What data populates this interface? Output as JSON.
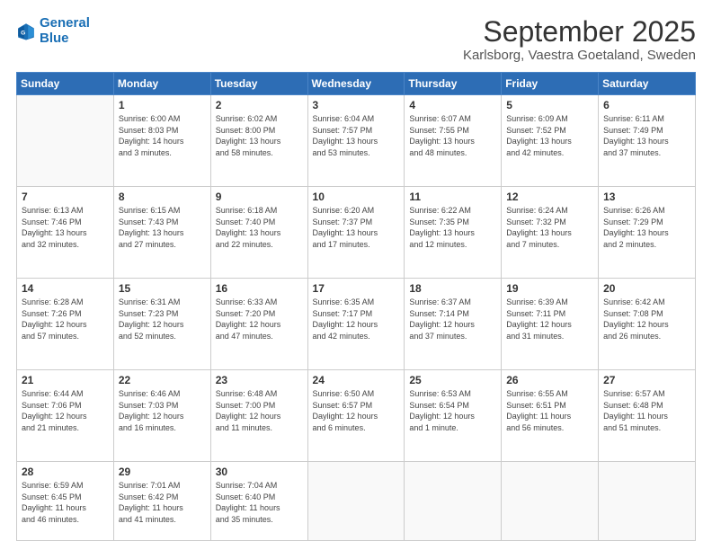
{
  "logo": {
    "line1": "General",
    "line2": "Blue"
  },
  "header": {
    "month": "September 2025",
    "location": "Karlsborg, Vaestra Goetaland, Sweden"
  },
  "weekdays": [
    "Sunday",
    "Monday",
    "Tuesday",
    "Wednesday",
    "Thursday",
    "Friday",
    "Saturday"
  ],
  "weeks": [
    [
      {
        "day": "",
        "info": ""
      },
      {
        "day": "1",
        "info": "Sunrise: 6:00 AM\nSunset: 8:03 PM\nDaylight: 14 hours\nand 3 minutes."
      },
      {
        "day": "2",
        "info": "Sunrise: 6:02 AM\nSunset: 8:00 PM\nDaylight: 13 hours\nand 58 minutes."
      },
      {
        "day": "3",
        "info": "Sunrise: 6:04 AM\nSunset: 7:57 PM\nDaylight: 13 hours\nand 53 minutes."
      },
      {
        "day": "4",
        "info": "Sunrise: 6:07 AM\nSunset: 7:55 PM\nDaylight: 13 hours\nand 48 minutes."
      },
      {
        "day": "5",
        "info": "Sunrise: 6:09 AM\nSunset: 7:52 PM\nDaylight: 13 hours\nand 42 minutes."
      },
      {
        "day": "6",
        "info": "Sunrise: 6:11 AM\nSunset: 7:49 PM\nDaylight: 13 hours\nand 37 minutes."
      }
    ],
    [
      {
        "day": "7",
        "info": "Sunrise: 6:13 AM\nSunset: 7:46 PM\nDaylight: 13 hours\nand 32 minutes."
      },
      {
        "day": "8",
        "info": "Sunrise: 6:15 AM\nSunset: 7:43 PM\nDaylight: 13 hours\nand 27 minutes."
      },
      {
        "day": "9",
        "info": "Sunrise: 6:18 AM\nSunset: 7:40 PM\nDaylight: 13 hours\nand 22 minutes."
      },
      {
        "day": "10",
        "info": "Sunrise: 6:20 AM\nSunset: 7:37 PM\nDaylight: 13 hours\nand 17 minutes."
      },
      {
        "day": "11",
        "info": "Sunrise: 6:22 AM\nSunset: 7:35 PM\nDaylight: 13 hours\nand 12 minutes."
      },
      {
        "day": "12",
        "info": "Sunrise: 6:24 AM\nSunset: 7:32 PM\nDaylight: 13 hours\nand 7 minutes."
      },
      {
        "day": "13",
        "info": "Sunrise: 6:26 AM\nSunset: 7:29 PM\nDaylight: 13 hours\nand 2 minutes."
      }
    ],
    [
      {
        "day": "14",
        "info": "Sunrise: 6:28 AM\nSunset: 7:26 PM\nDaylight: 12 hours\nand 57 minutes."
      },
      {
        "day": "15",
        "info": "Sunrise: 6:31 AM\nSunset: 7:23 PM\nDaylight: 12 hours\nand 52 minutes."
      },
      {
        "day": "16",
        "info": "Sunrise: 6:33 AM\nSunset: 7:20 PM\nDaylight: 12 hours\nand 47 minutes."
      },
      {
        "day": "17",
        "info": "Sunrise: 6:35 AM\nSunset: 7:17 PM\nDaylight: 12 hours\nand 42 minutes."
      },
      {
        "day": "18",
        "info": "Sunrise: 6:37 AM\nSunset: 7:14 PM\nDaylight: 12 hours\nand 37 minutes."
      },
      {
        "day": "19",
        "info": "Sunrise: 6:39 AM\nSunset: 7:11 PM\nDaylight: 12 hours\nand 31 minutes."
      },
      {
        "day": "20",
        "info": "Sunrise: 6:42 AM\nSunset: 7:08 PM\nDaylight: 12 hours\nand 26 minutes."
      }
    ],
    [
      {
        "day": "21",
        "info": "Sunrise: 6:44 AM\nSunset: 7:06 PM\nDaylight: 12 hours\nand 21 minutes."
      },
      {
        "day": "22",
        "info": "Sunrise: 6:46 AM\nSunset: 7:03 PM\nDaylight: 12 hours\nand 16 minutes."
      },
      {
        "day": "23",
        "info": "Sunrise: 6:48 AM\nSunset: 7:00 PM\nDaylight: 12 hours\nand 11 minutes."
      },
      {
        "day": "24",
        "info": "Sunrise: 6:50 AM\nSunset: 6:57 PM\nDaylight: 12 hours\nand 6 minutes."
      },
      {
        "day": "25",
        "info": "Sunrise: 6:53 AM\nSunset: 6:54 PM\nDaylight: 12 hours\nand 1 minute."
      },
      {
        "day": "26",
        "info": "Sunrise: 6:55 AM\nSunset: 6:51 PM\nDaylight: 11 hours\nand 56 minutes."
      },
      {
        "day": "27",
        "info": "Sunrise: 6:57 AM\nSunset: 6:48 PM\nDaylight: 11 hours\nand 51 minutes."
      }
    ],
    [
      {
        "day": "28",
        "info": "Sunrise: 6:59 AM\nSunset: 6:45 PM\nDaylight: 11 hours\nand 46 minutes."
      },
      {
        "day": "29",
        "info": "Sunrise: 7:01 AM\nSunset: 6:42 PM\nDaylight: 11 hours\nand 41 minutes."
      },
      {
        "day": "30",
        "info": "Sunrise: 7:04 AM\nSunset: 6:40 PM\nDaylight: 11 hours\nand 35 minutes."
      },
      {
        "day": "",
        "info": ""
      },
      {
        "day": "",
        "info": ""
      },
      {
        "day": "",
        "info": ""
      },
      {
        "day": "",
        "info": ""
      }
    ]
  ]
}
